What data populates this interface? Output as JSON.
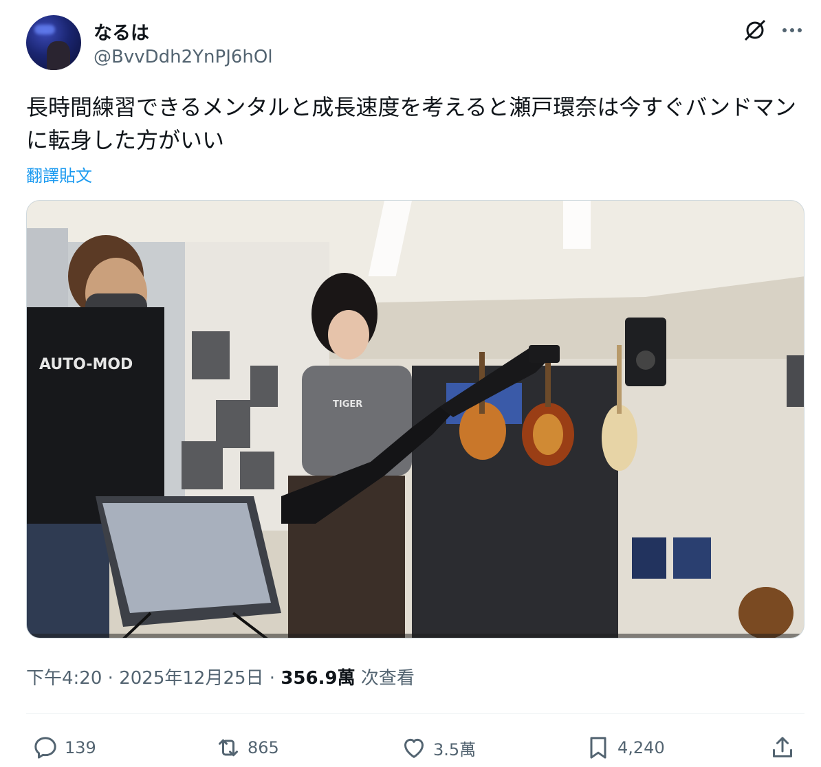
{
  "user": {
    "display_name": "なるは",
    "handle": "@BvvDdh2YnPJ6hOl"
  },
  "tweet": {
    "text": "長時間練習できるメンタルと成長速度を考えると瀬戸環奈は今すぐバンドマンに転身した方がいい",
    "translate_label": "翻譯貼文"
  },
  "media": {
    "shirt_text": "AUTO-MOD",
    "shirt_text_girl": "TIGER"
  },
  "meta": {
    "time": "下午4:20",
    "sep1": " · ",
    "date": "2025年12月25日",
    "sep2": " · ",
    "views": "356.9萬",
    "views_suffix": " 次查看"
  },
  "actions": {
    "replies": "139",
    "reposts": "865",
    "likes": "3.5萬",
    "bookmarks": "4,240"
  },
  "icons": [
    "grok-icon",
    "more-icon",
    "reply-icon",
    "repost-icon",
    "like-icon",
    "bookmark-icon",
    "share-icon"
  ]
}
